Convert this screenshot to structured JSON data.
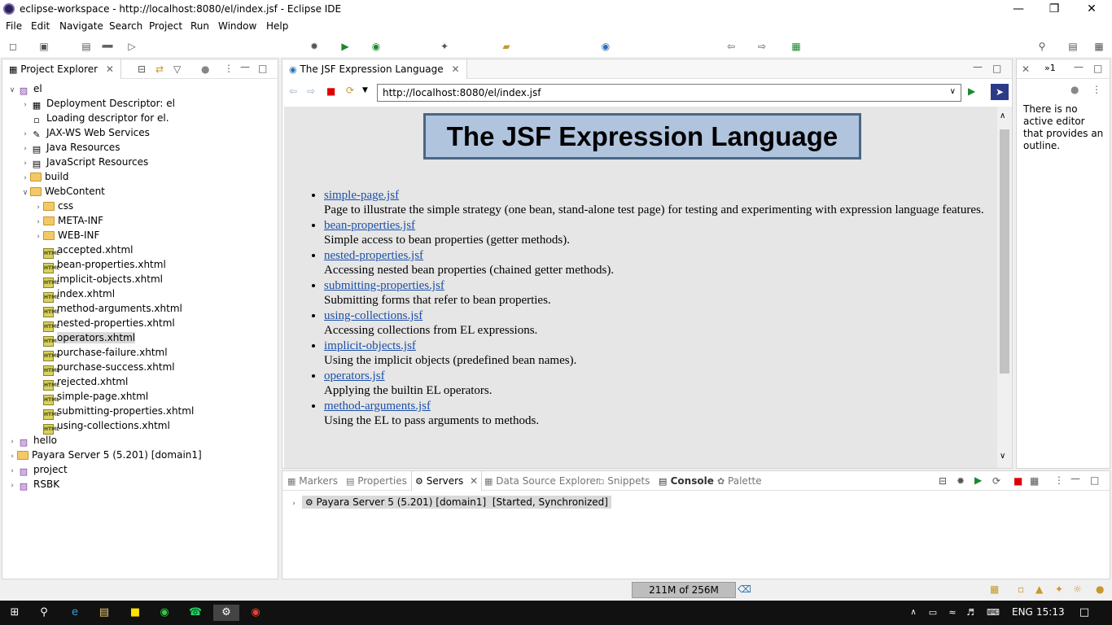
{
  "window": {
    "title": "eclipse-workspace - http://localhost:8080/el/index.jsf - Eclipse IDE"
  },
  "menu": [
    "File",
    "Edit",
    "Navigate",
    "Search",
    "Project",
    "Run",
    "Window",
    "Help"
  ],
  "project_explorer": {
    "tab_label": "Project Explorer",
    "tree": [
      {
        "label": "el",
        "level": 0,
        "expanded": true
      },
      {
        "label": "Deployment Descriptor: el",
        "level": 1
      },
      {
        "label": "Loading descriptor for el.",
        "level": 1
      },
      {
        "label": "JAX-WS Web Services",
        "level": 1
      },
      {
        "label": "Java Resources",
        "level": 1
      },
      {
        "label": "JavaScript Resources",
        "level": 1
      },
      {
        "label": "build",
        "level": 1
      },
      {
        "label": "WebContent",
        "level": 1,
        "expanded": true
      },
      {
        "label": "css",
        "level": 2
      },
      {
        "label": "META-INF",
        "level": 2
      },
      {
        "label": "WEB-INF",
        "level": 2
      },
      {
        "label": "accepted.xhtml",
        "level": 2
      },
      {
        "label": "bean-properties.xhtml",
        "level": 2
      },
      {
        "label": "implicit-objects.xhtml",
        "level": 2
      },
      {
        "label": "index.xhtml",
        "level": 2
      },
      {
        "label": "method-arguments.xhtml",
        "level": 2
      },
      {
        "label": "nested-properties.xhtml",
        "level": 2
      },
      {
        "label": "operators.xhtml",
        "level": 2,
        "selected": true
      },
      {
        "label": "purchase-failure.xhtml",
        "level": 2
      },
      {
        "label": "purchase-success.xhtml",
        "level": 2
      },
      {
        "label": "rejected.xhtml",
        "level": 2
      },
      {
        "label": "simple-page.xhtml",
        "level": 2
      },
      {
        "label": "submitting-properties.xhtml",
        "level": 2
      },
      {
        "label": "using-collections.xhtml",
        "level": 2
      },
      {
        "label": "hello",
        "level": 0
      },
      {
        "label": "Payara Server 5 (5.201) [domain1]",
        "level": 0
      },
      {
        "label": "project",
        "level": 0
      },
      {
        "label": "RSBK",
        "level": 0
      }
    ]
  },
  "browser": {
    "tab_label": "The JSF Expression Language",
    "url": "http://localhost:8080/el/index.jsf",
    "page": {
      "heading": "The JSF Expression Language",
      "items": [
        {
          "link": "simple-page.jsf",
          "desc": "Page to illustrate the simple strategy (one bean, stand-alone test page) for testing and experimenting with expression language features."
        },
        {
          "link": "bean-properties.jsf",
          "desc": "Simple access to bean properties (getter methods)."
        },
        {
          "link": "nested-properties.jsf",
          "desc": "Accessing nested bean properties (chained getter methods)."
        },
        {
          "link": "submitting-properties.jsf",
          "desc": "Submitting forms that refer to bean properties."
        },
        {
          "link": "using-collections.jsf",
          "desc": "Accessing collections from EL expressions."
        },
        {
          "link": "implicit-objects.jsf",
          "desc": "Using the implicit objects (predefined bean names)."
        },
        {
          "link": "operators.jsf",
          "desc": "Applying the builtin EL operators."
        },
        {
          "link": "method-arguments.jsf",
          "desc": "Using the EL to pass arguments to methods."
        }
      ]
    }
  },
  "outline": {
    "tab_label": "1",
    "message": "There is no active editor that provides an outline."
  },
  "bottom_tabs": [
    "Markers",
    "Properties",
    "Servers",
    "Data Source Explorer",
    "Snippets",
    "Console",
    "Palette"
  ],
  "servers": [
    {
      "name": "Payara Server 5 (5.201) [domain1]",
      "status": "[Started, Synchronized]"
    }
  ],
  "status": {
    "heap": "211M of 256M"
  },
  "taskbar": {
    "lang": "ENG",
    "time": "15:13"
  }
}
